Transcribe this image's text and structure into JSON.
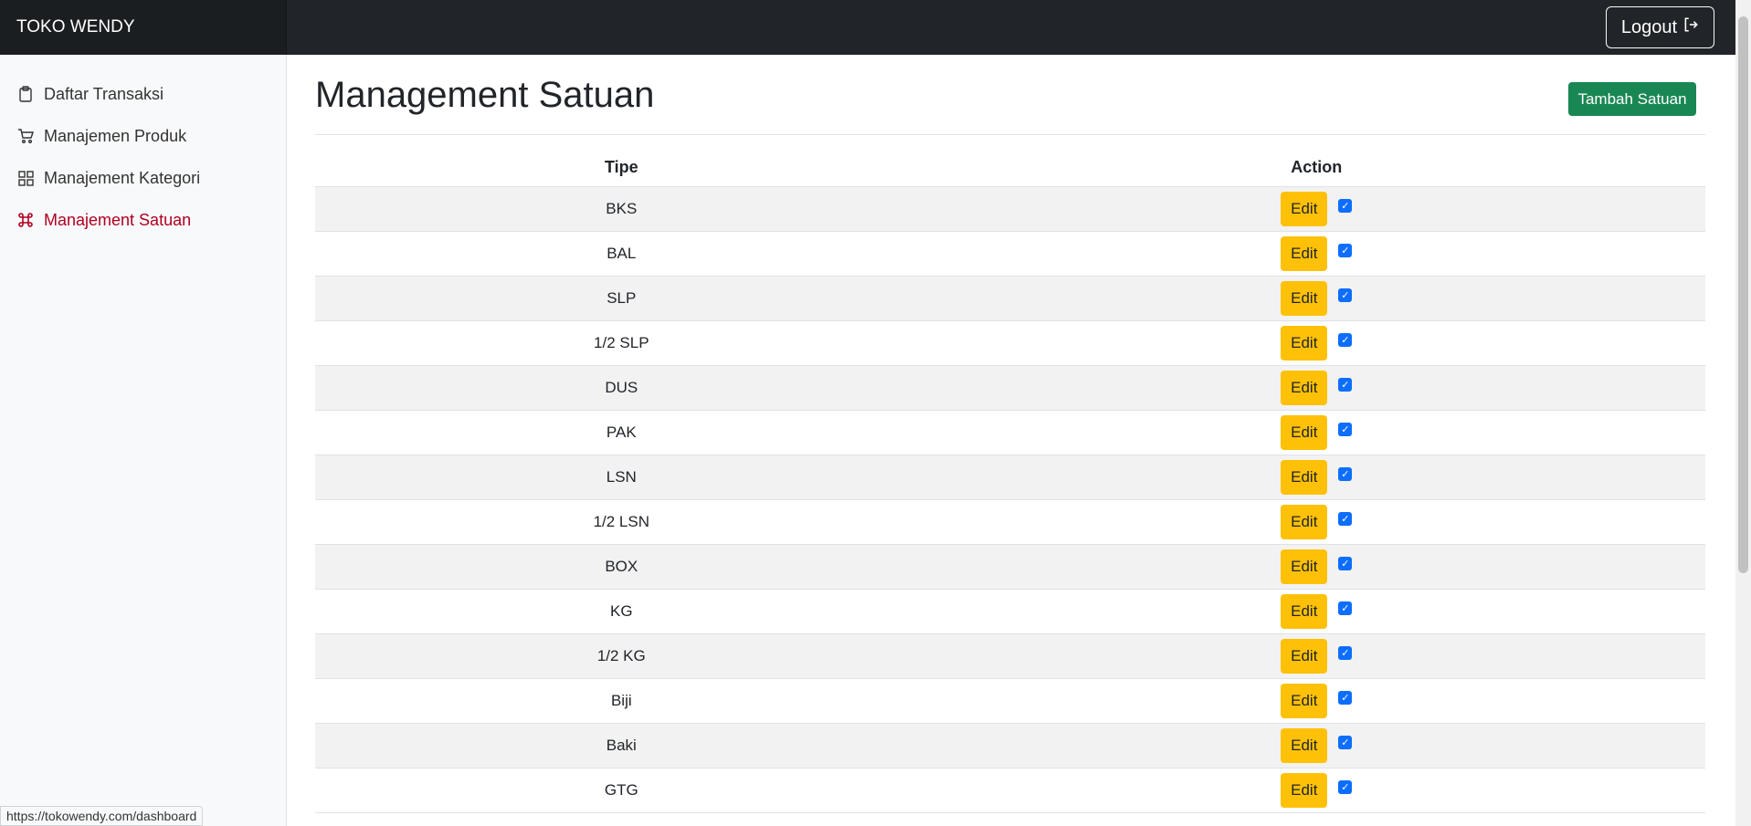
{
  "brand": "TOKO WENDY",
  "logout_label": "Logout",
  "sidebar": {
    "items": [
      {
        "label": "Daftar Transaksi",
        "icon": "clipboard-icon"
      },
      {
        "label": "Manajemen Produk",
        "icon": "cart-icon"
      },
      {
        "label": "Manajement Kategori",
        "icon": "grid-icon"
      },
      {
        "label": "Manajement Satuan",
        "icon": "command-icon",
        "active": true
      }
    ]
  },
  "main": {
    "title": "Management Satuan",
    "add_button": "Tambah Satuan",
    "table": {
      "headers": [
        "Tipe",
        "Action"
      ],
      "rows": [
        "BKS",
        "BAL",
        "SLP",
        "1/2 SLP",
        "DUS",
        "PAK",
        "LSN",
        "1/2 LSN",
        "BOX",
        "KG",
        "1/2 KG",
        "Biji",
        "Baki",
        "GTG"
      ],
      "edit_label": "Edit",
      "checked": true
    }
  },
  "status_url": "https://tokowendy.com/dashboard",
  "colors": {
    "topbar": "#212529",
    "add_button": "#198754",
    "edit_button": "#ffc107",
    "active_nav": "#b00020"
  }
}
